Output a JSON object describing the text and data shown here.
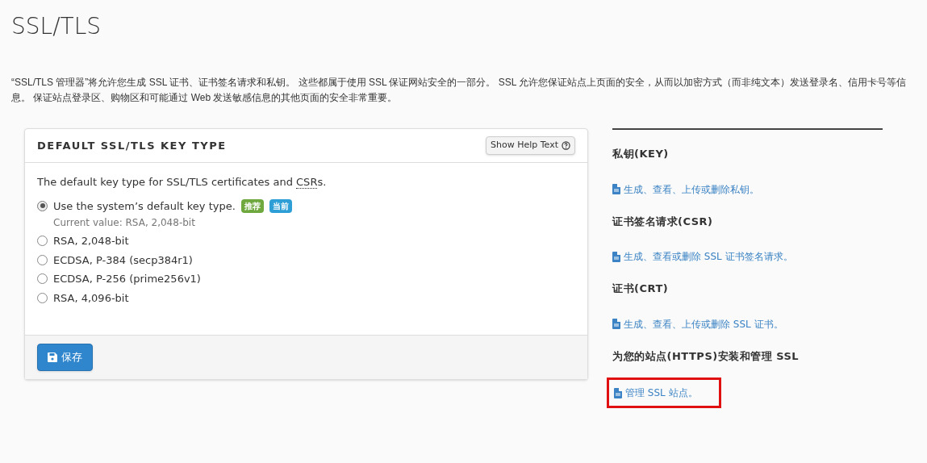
{
  "page_title": "SSL/TLS",
  "description": "“SSL/TLS 管理器”将允许您生成 SSL 证书、证书签名请求和私钥。 这些都属于使用 SSL 保证网站安全的一部分。 SSL 允许您保证站点上页面的安全，从而以加密方式（而非纯文本）发送登录名、信用卡号等信息。 保证站点登录区、购物区和可能通过 Web 发送敏感信息的其他页面的安全非常重要。",
  "card": {
    "title": "DEFAULT SSL/TLS KEY TYPE",
    "help_button": "Show Help Text",
    "intro": {
      "before": "The default key type for SSL/TLS certificates and ",
      "abbr": "CSR",
      "after": "s."
    },
    "options": [
      {
        "label": "Use the system’s default key type.",
        "selected": true,
        "badges": [
          {
            "text": "推荐",
            "color": "#6ea83e"
          },
          {
            "text": "当前",
            "color": "#2e9fd6"
          }
        ],
        "note": "Current value: RSA, 2,048-bit"
      },
      {
        "label": "RSA, 2,048-bit",
        "selected": false
      },
      {
        "label": "ECDSA, P-384 (secp384r1)",
        "selected": false
      },
      {
        "label": "ECDSA, P-256 (prime256v1)",
        "selected": false
      },
      {
        "label": "RSA, 4,096-bit",
        "selected": false
      }
    ],
    "save_button": "保存"
  },
  "sidebar": [
    {
      "heading": "私钥(KEY)",
      "link": "生成、查看、上传或删除私钥。",
      "highlighted": false
    },
    {
      "heading": "证书签名请求(CSR)",
      "link": "生成、查看或删除 SSL 证书签名请求。",
      "highlighted": false
    },
    {
      "heading": "证书(CRT)",
      "link": "生成、查看、上传或删除 SSL 证书。",
      "highlighted": false
    },
    {
      "heading": "为您的站点(HTTPS)安装和管理 SSL",
      "link": "管理 SSL 站点。",
      "highlighted": true
    }
  ]
}
